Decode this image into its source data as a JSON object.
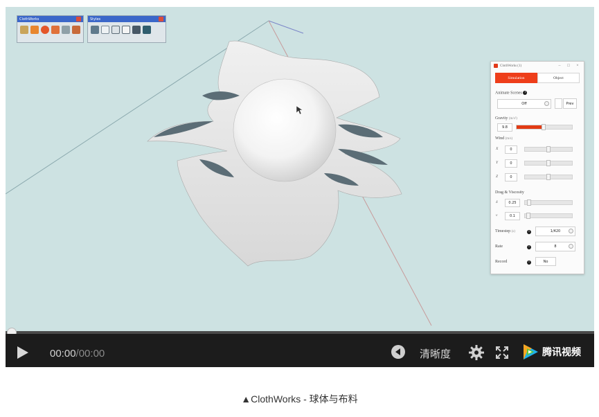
{
  "toolbars": [
    {
      "title": "ClothWorks",
      "icons": [
        "cloth-tool-icon",
        "play-icon",
        "stop-icon",
        "rewind-icon",
        "pin-icon",
        "weight-icon"
      ]
    },
    {
      "title": "Styles",
      "icons": [
        "xray-style-icon",
        "wireframe-style-icon",
        "hidden-line-style-icon",
        "shaded-style-icon",
        "textured-style-icon",
        "monochrome-style-icon"
      ]
    }
  ],
  "panel": {
    "title": "ClothWorks (1)",
    "tabs": [
      {
        "label": "Simulation",
        "active": true
      },
      {
        "label": "Object",
        "active": false
      }
    ],
    "animate_scenes": {
      "label": "Animate Scenes",
      "value": "Off",
      "button": "Prev"
    },
    "gravity": {
      "label": "Gravity",
      "unit": "(m/s²)",
      "value": "9.8",
      "fill": 0.48
    },
    "wind": {
      "label": "Wind",
      "unit": "(m/s)",
      "axes": [
        {
          "axis": "X",
          "value": "0",
          "pos": 0.5
        },
        {
          "axis": "Y",
          "value": "0",
          "pos": 0.5
        },
        {
          "axis": "Z",
          "value": "0",
          "pos": 0.5
        }
      ]
    },
    "drag": {
      "label": "Drag & Viscosity",
      "items": [
        {
          "symbol": "δ",
          "value": "0.25",
          "pos": 0.05
        },
        {
          "symbol": "ν",
          "value": "0.1",
          "pos": 0.03
        }
      ]
    },
    "timestep": {
      "label": "Timestep",
      "unit": "(s)",
      "value": "1/420"
    },
    "rate": {
      "label": "Rate",
      "value": "8"
    },
    "record": {
      "label": "Record",
      "value": "No"
    }
  },
  "player": {
    "current_time": "00:00",
    "separator": "/",
    "duration": "00:00",
    "progress": 0,
    "quality_label": "清晰度",
    "brand": "腾讯视频"
  },
  "caption": "▲ClothWorks - 球体与布料",
  "colors": {
    "viewport_bg": "#cde2e2",
    "accent": "#ee3e1a",
    "control_bar": "#1c1c1c"
  }
}
